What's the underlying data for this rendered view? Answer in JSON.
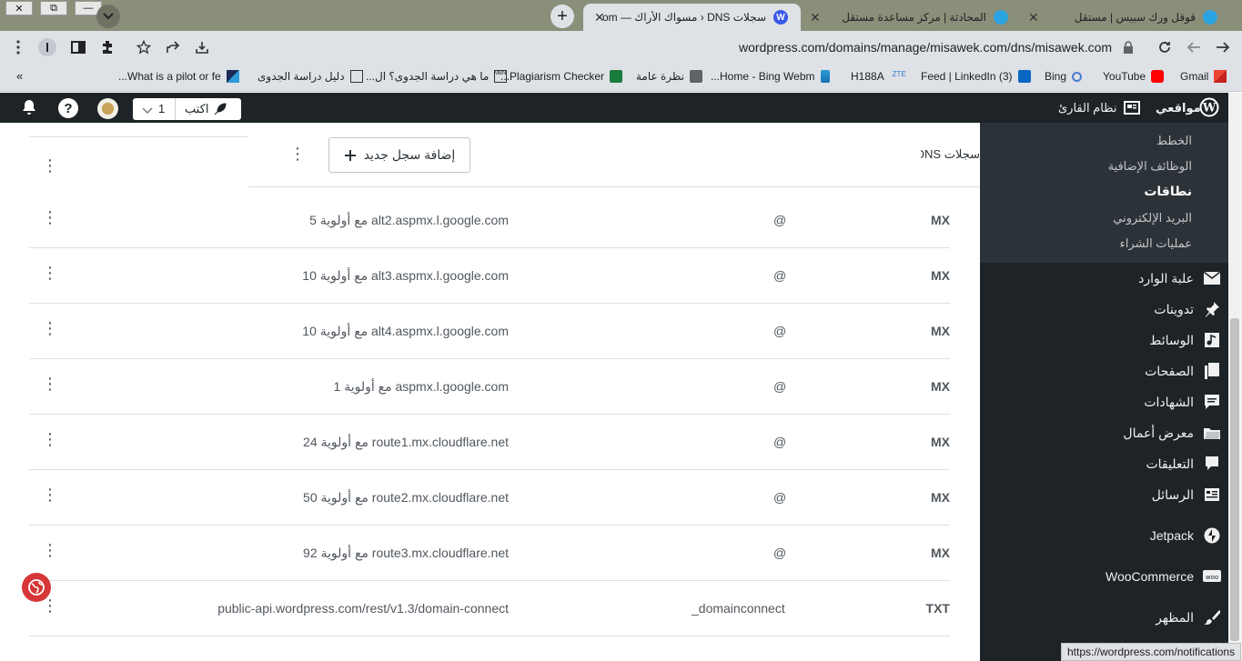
{
  "window": {
    "close_symbol": "✕",
    "restore_symbol": "⧉",
    "minimize_symbol": "—"
  },
  "tabs": [
    {
      "title": "قوقل ورك سبيس | مستقل",
      "active": false
    },
    {
      "title": "المحادثة | مركز مساعدة مستقل",
      "active": false
    },
    {
      "title": "سجلات DNS ‹ مسواك الأراك — s.com",
      "active": true
    }
  ],
  "new_tab_symbol": "+",
  "omnibox": {
    "url": "wordpress.com/domains/manage/misawek.com/dns/misawek.com"
  },
  "bookmarks": [
    {
      "label": "Gmail",
      "icon": "gmail-icon"
    },
    {
      "label": "YouTube",
      "icon": "youtube-icon"
    },
    {
      "label": "Bing",
      "icon": "search-icon"
    },
    {
      "label": "(3) Feed | LinkedIn",
      "icon": "linkedin-icon"
    },
    {
      "label": "H188A",
      "icon": "zte-icon"
    },
    {
      "label": "Home - Bing Webm...",
      "icon": "bing-icon"
    },
    {
      "label": "نظرة عامة",
      "icon": "store-icon"
    },
    {
      "label": "Plagiarism Checker...",
      "icon": "plagiarism-icon"
    },
    {
      "label": "ما هي دراسة الجدوى؟ ال...",
      "icon": "mbn-icon"
    },
    {
      "label": "دليل دراسة الجدوى",
      "icon": "home-icon"
    },
    {
      "label": "What is a pilot or fe...",
      "icon": "bookmark-icon"
    }
  ],
  "bookmarks_overflow": "»",
  "adminbar": {
    "my_sites": "مواقعي",
    "reader": "نظام القارئ",
    "write": "اكتب",
    "notif_count": "1"
  },
  "submenu": [
    "الخطط",
    "الوظائف الإضافية",
    "نطاقات",
    "البريد الإلكتروني",
    "عمليات الشراء"
  ],
  "menu": [
    {
      "label": "علبة الوارد",
      "icon": "envelope-icon"
    },
    {
      "label": "تدوينات",
      "icon": "pin-icon"
    },
    {
      "label": "الوسائط",
      "icon": "media-icon"
    },
    {
      "label": "الصفحات",
      "icon": "pages-icon"
    },
    {
      "label": "الشهادات",
      "icon": "testimonial-icon"
    },
    {
      "label": "معرض أعمال",
      "icon": "portfolio-icon"
    },
    {
      "label": "التعليقات",
      "icon": "comment-icon"
    },
    {
      "label": "الرسائل",
      "icon": "feedback-icon"
    },
    {
      "label": "Jetpack",
      "icon": "jetpack-icon"
    },
    {
      "label": "WooCommerce",
      "icon": "woocommerce-icon"
    },
    {
      "label": "المظهر",
      "icon": "brush-icon"
    }
  ],
  "header": {
    "title": "سجلات DNS",
    "add_button": "إضافة سجل جديد"
  },
  "records": [
    {
      "type": "MX",
      "name": "@",
      "value": "alt2.aspmx.l.google.com مع أولوية 5"
    },
    {
      "type": "MX",
      "name": "@",
      "value": "alt3.aspmx.l.google.com مع أولوية 10"
    },
    {
      "type": "MX",
      "name": "@",
      "value": "alt4.aspmx.l.google.com مع أولوية 10"
    },
    {
      "type": "MX",
      "name": "@",
      "value": "aspmx.l.google.com مع أولوية 1"
    },
    {
      "type": "MX",
      "name": "@",
      "value": "route1.mx.cloudflare.net مع أولوية 24"
    },
    {
      "type": "MX",
      "name": "@",
      "value": "route2.mx.cloudflare.net مع أولوية 50"
    },
    {
      "type": "MX",
      "name": "@",
      "value": "route3.mx.cloudflare.net مع أولوية 92"
    },
    {
      "type": "TXT",
      "name": "_domainconnect",
      "value": "public-api.wordpress.com/rest/v1.3/domain-connect"
    }
  ],
  "kebab": "⋮",
  "status_url": "https://wordpress.com/notifications",
  "colors": {
    "wp_dark": "#1d2327",
    "accent_red": "#d63638"
  }
}
